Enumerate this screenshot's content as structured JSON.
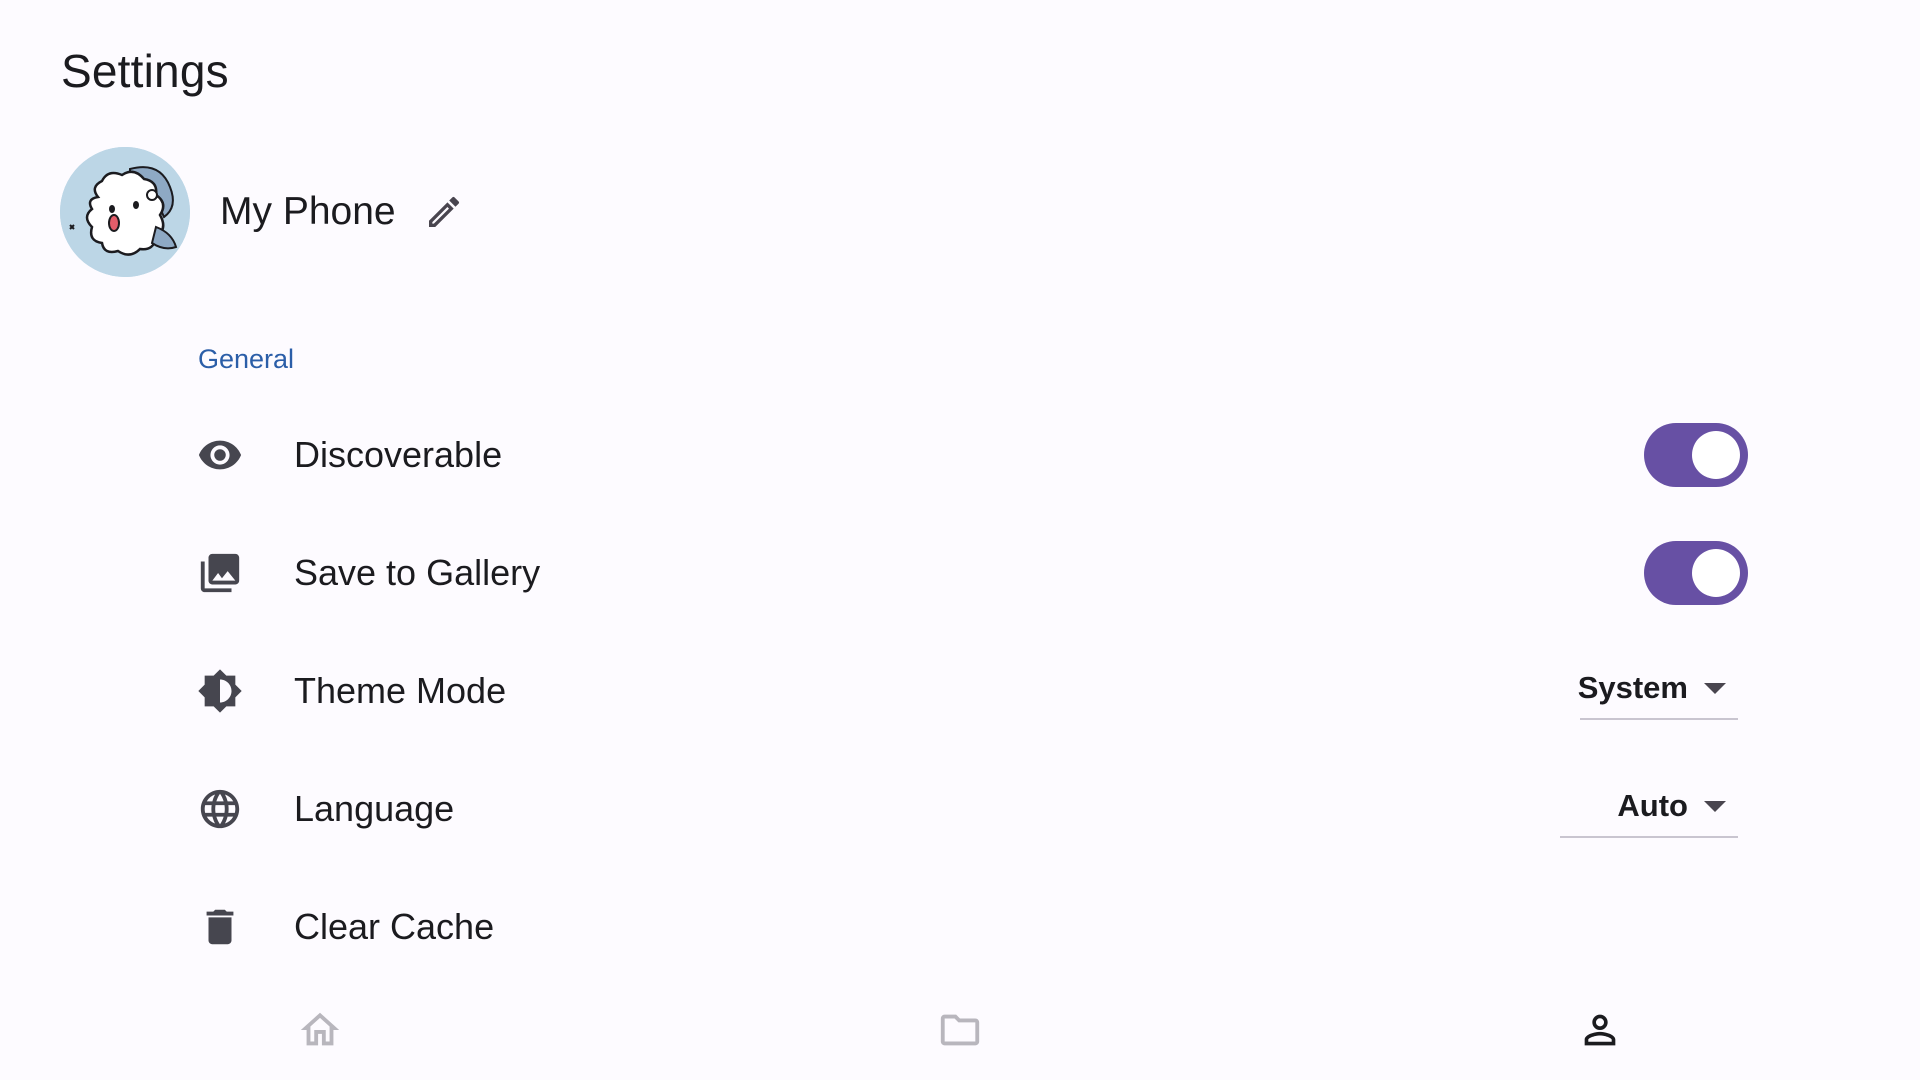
{
  "page": {
    "title": "Settings"
  },
  "profile": {
    "device_name": "My Phone",
    "avatar_icon": "cartoon-avatar",
    "edit_icon": "pencil-icon"
  },
  "sections": {
    "general": {
      "label": "General",
      "items": [
        {
          "label": "Discoverable",
          "icon": "eye-icon",
          "control": "toggle",
          "enabled": true
        },
        {
          "label": "Save to Gallery",
          "icon": "gallery-icon",
          "control": "toggle",
          "enabled": true
        },
        {
          "label": "Theme Mode",
          "icon": "brightness-icon",
          "control": "dropdown",
          "value": "System"
        },
        {
          "label": "Language",
          "icon": "globe-icon",
          "control": "dropdown",
          "value": "Auto"
        },
        {
          "label": "Clear Cache",
          "icon": "trash-icon",
          "control": "none"
        }
      ]
    }
  },
  "bottom_nav": {
    "items": [
      {
        "icon": "home-icon",
        "active": false
      },
      {
        "icon": "folder-icon",
        "active": false
      },
      {
        "icon": "person-icon",
        "active": true
      }
    ]
  },
  "colors": {
    "accent": "#6750a4",
    "section_label": "#2b5ea8",
    "background": "#fdfbff",
    "nav_inactive": "#b8b6bd",
    "nav_active": "#1b1b1f"
  }
}
